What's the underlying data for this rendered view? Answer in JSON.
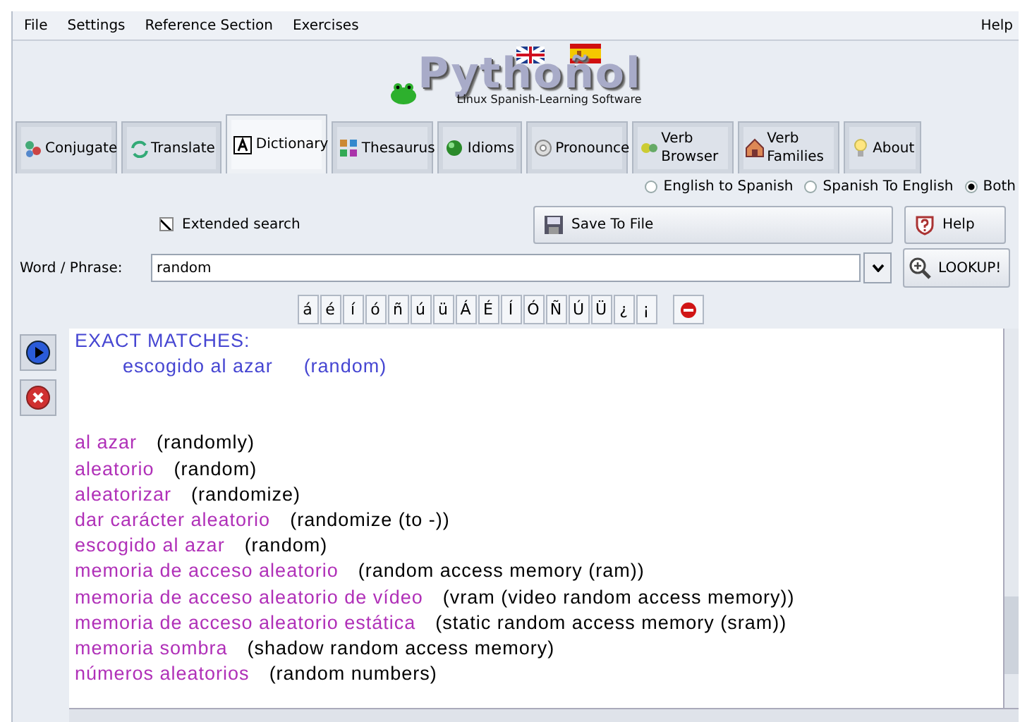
{
  "menu": [
    {
      "label": "File"
    },
    {
      "label": "Settings"
    },
    {
      "label": "Reference Section"
    },
    {
      "label": "Exercises"
    }
  ],
  "menu_right": {
    "label": "Help"
  },
  "logo": {
    "title": "Pythoñol",
    "subtitle": "Linux Spanish-Learning Software"
  },
  "tabs": [
    {
      "label": "Conjugate",
      "selected": false
    },
    {
      "label": "Translate",
      "selected": false
    },
    {
      "label": "Dictionary",
      "selected": true
    },
    {
      "label": "Thesaurus",
      "selected": false
    },
    {
      "label": "Idioms",
      "selected": false
    },
    {
      "label": "Pronounce",
      "selected": false
    },
    {
      "label": "Verb Browser",
      "selected": false
    },
    {
      "label": "Verb Families",
      "selected": false
    },
    {
      "label": "About",
      "selected": false
    }
  ],
  "directions": [
    {
      "label": "English to Spanish",
      "selected": false
    },
    {
      "label": "Spanish To English",
      "selected": false
    },
    {
      "label": "Both",
      "selected": true
    }
  ],
  "extended_search": {
    "label": "Extended search",
    "checked": true
  },
  "save_button": "Save To File",
  "help_button": "Help",
  "word_label": "Word / Phrase:",
  "word_field": {
    "value": "random"
  },
  "lookup_button": "LOOKUP!",
  "accent_keys": [
    "á",
    "é",
    "í",
    "ó",
    "ñ",
    "ú",
    "ü",
    "Á",
    "É",
    "Í",
    "Ó",
    "Ñ",
    "Ú",
    "Ü",
    "¿",
    "¡"
  ],
  "results": {
    "heading": "EXACT MATCHES:",
    "exact": [
      {
        "spanish": "escogido al azar",
        "english": "(random)"
      }
    ],
    "matches": [
      {
        "spanish": "al azar",
        "english": "(randomly)"
      },
      {
        "spanish": "aleatorio",
        "english": "(random)"
      },
      {
        "spanish": "aleatorizar",
        "english": "(randomize)"
      },
      {
        "spanish": "dar carácter aleatorio",
        "english": "(randomize (to -))"
      },
      {
        "spanish": "escogido al azar",
        "english": "(random)"
      },
      {
        "spanish": "memoria de acceso aleatorio",
        "english": "(random access memory (ram))"
      },
      {
        "spanish": "memoria de acceso aleatorio de vídeo",
        "english": "(vram (video random access memory))"
      },
      {
        "spanish": "memoria de acceso aleatorio estática",
        "english": "(static random access memory (sram))"
      },
      {
        "spanish": "memoria sombra",
        "english": "(shadow random access memory)"
      },
      {
        "spanish": "números aleatorios",
        "english": "(random numbers)"
      }
    ]
  }
}
